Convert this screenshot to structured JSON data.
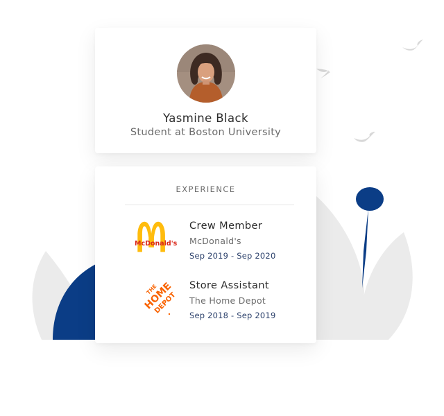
{
  "profile": {
    "name": "Yasmine Black",
    "subtitle": "Student at Boston University"
  },
  "experience": {
    "heading": "EXPERIENCE",
    "items": [
      {
        "title": "Crew Member",
        "company": "McDonald's",
        "dates": "Sep 2019 - Sep 2020",
        "logo_icon": "mcdonalds-logo",
        "logo_text": "McDonald's"
      },
      {
        "title": "Store Assistant",
        "company": "The Home Depot",
        "dates": "Sep 2018 - Sep 2019",
        "logo_icon": "home-depot-logo",
        "logo_text": "THE HOME DEPOT"
      }
    ]
  },
  "colors": {
    "accent_navy": "#0b3d86",
    "dates_text": "#2a3f6a",
    "decor_grey": "#ebebeb",
    "mcdonalds_yellow": "#ffbc0d",
    "mcdonalds_red": "#da291c",
    "home_depot_orange": "#f96302"
  }
}
